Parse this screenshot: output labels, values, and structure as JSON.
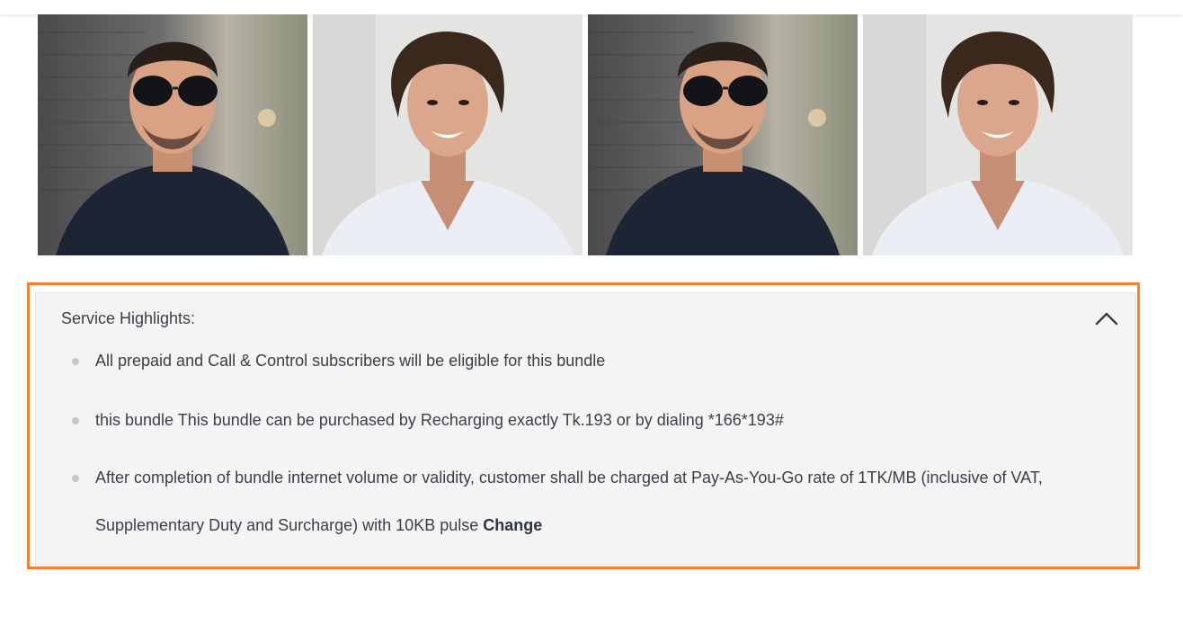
{
  "gallery": {
    "photos": [
      {
        "icon": "person-sunglasses-photo"
      },
      {
        "icon": "person-white-shirt-photo"
      },
      {
        "icon": "person-sunglasses-photo"
      },
      {
        "icon": "person-white-shirt-photo"
      }
    ]
  },
  "service_highlights": {
    "title": "Service Highlights:",
    "collapse_icon": "chevron-up-icon",
    "items": [
      {
        "text": "All prepaid and Call & Control subscribers will be eligible for this bundle"
      },
      {
        "text": "this bundle This bundle can be purchased by Recharging exactly Tk.193 or by dialing *166*193#"
      },
      {
        "text": "After completion of bundle internet volume or validity, customer shall be charged at Pay-As-You-Go rate of 1TK/MB (inclusive of VAT, Supplementary Duty and Surcharge) with 10KB pulse ",
        "link": "Change"
      }
    ]
  },
  "colors": {
    "highlight_border": "#f5822a",
    "panel_bg": "#f4f4f4",
    "text": "#3a3f4a"
  }
}
